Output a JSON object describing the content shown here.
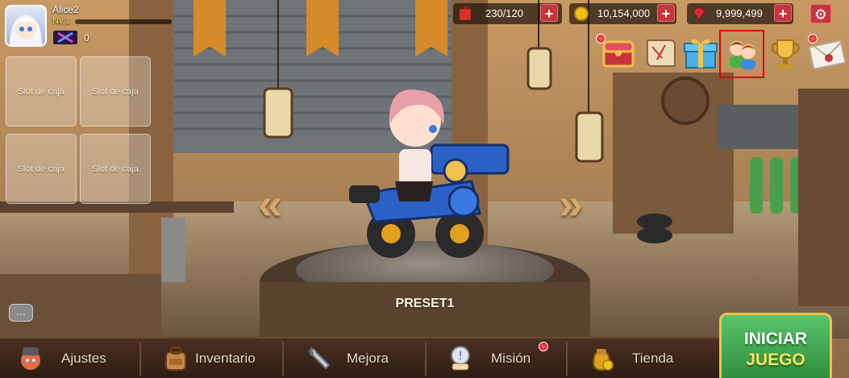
{
  "player": {
    "name": "Alice2",
    "level": "Nv.1",
    "xp_fraction": 0.0,
    "badge_count": "0"
  },
  "slots": {
    "label": "Slot de caja"
  },
  "currencies": {
    "energy": {
      "value": "230/120",
      "icon": "fuel-can-icon",
      "color": "#d8302c"
    },
    "coins": {
      "value": "10,154,000",
      "icon": "gold-coin-icon",
      "color": "#f2c21a"
    },
    "gems": {
      "value": "9,999,499",
      "icon": "ruby-gem-icon",
      "color": "#d8283c"
    },
    "plus_label": "+"
  },
  "top_icons": [
    "treasure-chest-icon",
    "scroll-map-icon",
    "gift-box-icon",
    "friends-icon",
    "trophy-icon",
    "mail-envelope-icon"
  ],
  "preset": "PRESET1",
  "chat_label": "…",
  "nav": {
    "ajustes": "Ajustes",
    "inventario": "Inventario",
    "mejora": "Mejora",
    "mision": "Misión",
    "tienda": "Tienda"
  },
  "start_button": {
    "line1": "INICIAR",
    "line2": "JUEGO"
  },
  "colors": {
    "accent_red": "#c8343e",
    "gold": "#f0c24a",
    "start_green": "#3aa84a"
  }
}
